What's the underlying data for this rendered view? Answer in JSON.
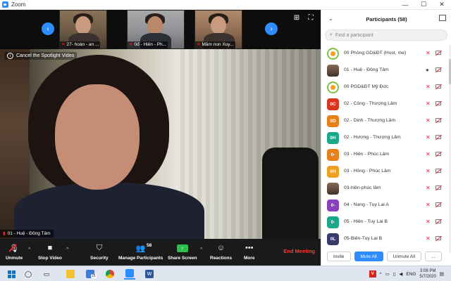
{
  "window": {
    "title": "Zoom",
    "minimize": "—",
    "maximize": "☐",
    "close": "✕"
  },
  "spotlight": {
    "cancel_label": "Cancel the Spotlight Video",
    "name_tag": "01 - Huệ - Đông Tâm"
  },
  "gallery": [
    {
      "label": "27- hoàn - an ..."
    },
    {
      "label": "0đ - Hiên - Ph..."
    },
    {
      "label": "Mầm non Xuy..."
    }
  ],
  "toolbar": {
    "unmute": "Unmute",
    "stop_video": "Stop Video",
    "security": "Security",
    "manage_participants": "Manage Participants",
    "participant_count": "58",
    "share_screen": "Share Screen",
    "reactions": "Reactions",
    "more": "More",
    "end_meeting": "End Meeting"
  },
  "panel": {
    "title": "Participants (58)",
    "search_placeholder": "Find a participant",
    "participants": [
      {
        "avatar": "",
        "avatar_type": "emblem",
        "name": "00 Phòng GD&ĐT (Host, me)",
        "mic": "muted",
        "color": ""
      },
      {
        "avatar": "",
        "avatar_type": "photo",
        "name": "01 - Huệ - Đông Tâm",
        "mic": "on",
        "color": ""
      },
      {
        "avatar": "",
        "avatar_type": "emblem",
        "name": "00 PGD&ĐT Mỹ Đức",
        "mic": "muted",
        "color": ""
      },
      {
        "avatar": "0C",
        "avatar_type": "text",
        "name": "02 - Công - Thượng Lâm",
        "mic": "muted",
        "color": "#d9341e"
      },
      {
        "avatar": "0D",
        "avatar_type": "text",
        "name": "02 - Dinh - Thượng Lâm",
        "mic": "muted",
        "color": "#e8801a"
      },
      {
        "avatar": "0H",
        "avatar_type": "text",
        "name": "02 - Hương - Thượng Lâm",
        "mic": "muted",
        "color": "#1aa88a"
      },
      {
        "avatar": "0-",
        "avatar_type": "text",
        "name": "03 - Hiên - Phúc Lâm",
        "mic": "muted",
        "color": "#e8801a"
      },
      {
        "avatar": "0H",
        "avatar_type": "text",
        "name": "03 - Hồng - Phúc Lâm",
        "mic": "muted",
        "color": "#f0a020"
      },
      {
        "avatar": "",
        "avatar_type": "photo",
        "name": "03-hiền-phúc lâm",
        "mic": "muted",
        "color": ""
      },
      {
        "avatar": "0-",
        "avatar_type": "text",
        "name": "04 - Nang - Tuy Lai A",
        "mic": "muted",
        "color": "#8a3fbf"
      },
      {
        "avatar": "0-",
        "avatar_type": "text",
        "name": "05 - Hiên - Tuy Lai B",
        "mic": "muted",
        "color": "#1aa88a"
      },
      {
        "avatar": "0L",
        "avatar_type": "text",
        "name": "05-Biên-Tuy Lai B",
        "mic": "muted",
        "color": "#3a3a6a"
      }
    ],
    "invite": "Invite",
    "mute_all": "Mute All",
    "unmute_all": "Unmute All",
    "more": "..."
  },
  "taskbar": {
    "folder_badge": "25",
    "language": "ENG",
    "time": "3:08 PM",
    "date": "5/7/2020"
  },
  "colors": {
    "accent": "#2d8cff",
    "end_meeting": "#ff3b30",
    "share_green": "#2dbf4d",
    "muted_red": "#e23"
  }
}
